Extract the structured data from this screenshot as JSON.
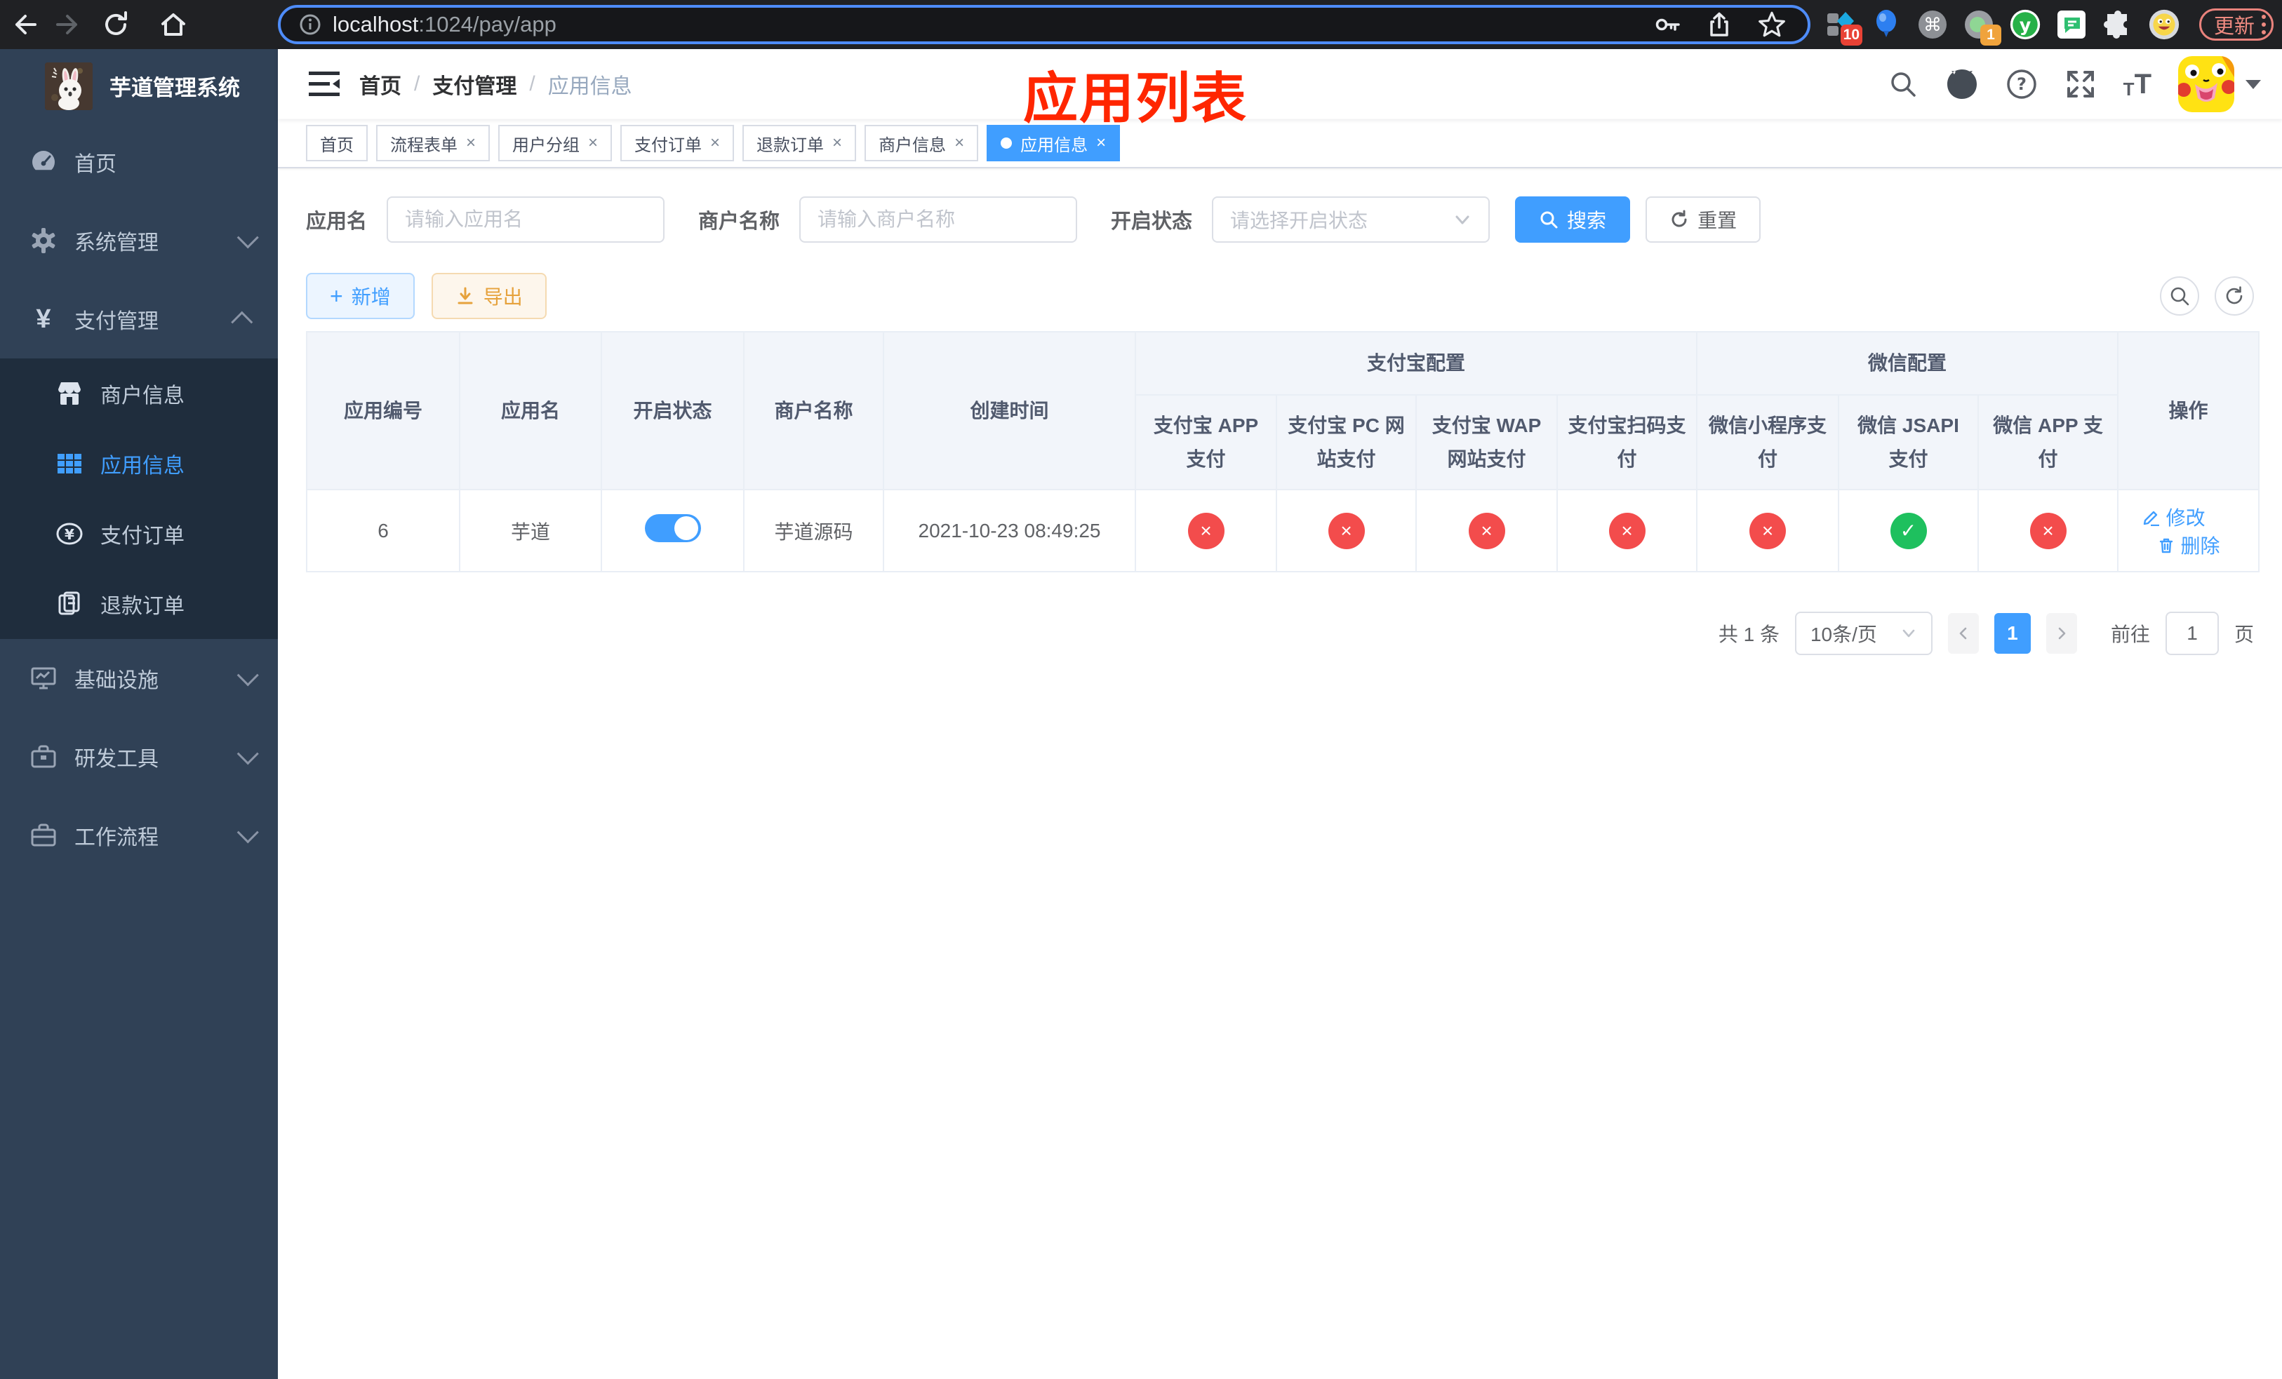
{
  "browser": {
    "url_host": "localhost",
    "url_rest": ":1024/pay/app",
    "update_label": "更新",
    "ext_badge_blue_diamond": "10",
    "ext_badge_recorder": "1",
    "ext_y_letter": "y"
  },
  "sidebar": {
    "title": "芋道管理系统",
    "items": [
      {
        "label": "首页"
      },
      {
        "label": "系统管理"
      },
      {
        "label": "支付管理"
      },
      {
        "label": "商户信息"
      },
      {
        "label": "应用信息"
      },
      {
        "label": "支付订单"
      },
      {
        "label": "退款订单"
      },
      {
        "label": "基础设施"
      },
      {
        "label": "研发工具"
      },
      {
        "label": "工作流程"
      }
    ]
  },
  "header": {
    "breadcrumb": [
      "首页",
      "支付管理",
      "应用信息"
    ],
    "annotation": "应用列表"
  },
  "tabs": [
    {
      "label": "首页"
    },
    {
      "label": "流程表单"
    },
    {
      "label": "用户分组"
    },
    {
      "label": "支付订单"
    },
    {
      "label": "退款订单"
    },
    {
      "label": "商户信息"
    },
    {
      "label": "应用信息"
    }
  ],
  "filters": {
    "app_name_label": "应用名",
    "app_name_placeholder": "请输入应用名",
    "merchant_label": "商户名称",
    "merchant_placeholder": "请输入商户名称",
    "status_label": "开启状态",
    "status_placeholder": "请选择开启状态",
    "search_label": "搜索",
    "reset_label": "重置"
  },
  "toolbar": {
    "add_label": "新增",
    "export_label": "导出"
  },
  "table": {
    "col_id": "应用编号",
    "col_name": "应用名",
    "col_status": "开启状态",
    "col_merchant": "商户名称",
    "col_created": "创建时间",
    "group_alipay": "支付宝配置",
    "group_wechat": "微信配置",
    "col_action": "操作",
    "sub_headers": [
      "支付宝 APP 支付",
      "支付宝 PC 网站支付",
      "支付宝 WAP 网站支付",
      "支付宝扫码支付",
      "微信小程序支付",
      "微信 JSAPI 支付",
      "微信 APP 支付"
    ],
    "rows": [
      {
        "id": "6",
        "name": "芋道",
        "toggle_cls": "switch on",
        "merchant": "芋道源码",
        "created": "2021-10-23 08:49:25",
        "statuses": [
          {
            "cls": "status-badge red",
            "glyph": "×"
          },
          {
            "cls": "status-badge red",
            "glyph": "×"
          },
          {
            "cls": "status-badge red",
            "glyph": "×"
          },
          {
            "cls": "status-badge red",
            "glyph": "×"
          },
          {
            "cls": "status-badge red",
            "glyph": "×"
          },
          {
            "cls": "status-badge green",
            "glyph": "✓"
          },
          {
            "cls": "status-badge red",
            "glyph": "×"
          }
        ],
        "edit_label": "修改",
        "delete_label": "删除"
      }
    ]
  },
  "pagination": {
    "total": "共 1 条",
    "page_size": "10条/页",
    "page": "1",
    "goto_label": "前往",
    "goto_value": "1",
    "page_suffix": "页"
  }
}
